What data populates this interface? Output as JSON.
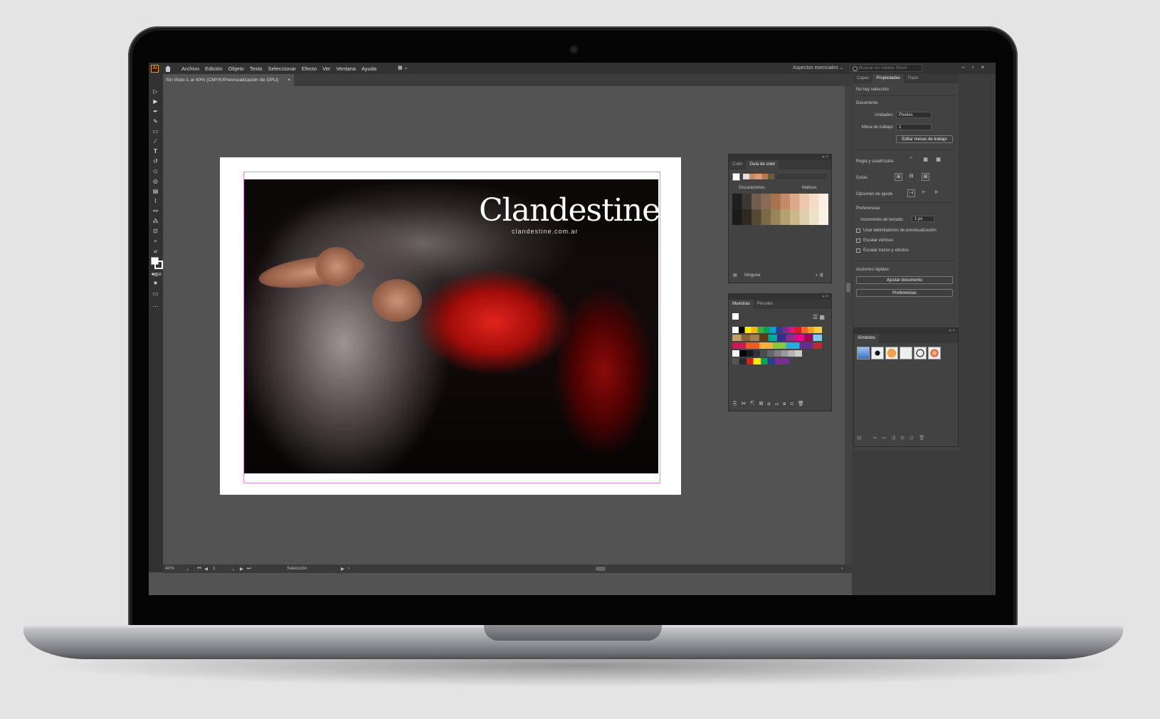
{
  "app": {
    "logo": "Ai",
    "menu": [
      "Archivo",
      "Edición",
      "Objeto",
      "Texto",
      "Seleccionar",
      "Efecto",
      "Ver",
      "Ventana",
      "Ayuda"
    ],
    "workspace": "Aspectos esenciales",
    "search_placeholder": "Buscar en Adobe Stock",
    "window_buttons": "–▫×"
  },
  "document": {
    "tab_title": "Sin título-1 al 40% (CMYK/Previsualización de GPU)",
    "close": "×"
  },
  "artwork": {
    "logo_text": "Clandestine",
    "logo_url": "clandestine.com.ar"
  },
  "status": {
    "zoom": "40%",
    "artboard_num": "1",
    "tool": "Selección"
  },
  "color_guide_panel": {
    "tabs": [
      "Color",
      "Guía de color"
    ],
    "col_left": "Oscuraciones",
    "col_right": "Matices",
    "footer": "Ninguna"
  },
  "swatches_panel": {
    "tabs": [
      "Muestras",
      "Pinceles"
    ]
  },
  "properties_panel": {
    "tabs": [
      "Capas",
      "Propiedades",
      "Trazo"
    ],
    "no_selection": "No hay selección",
    "document_heading": "Documento",
    "units_label": "Unidades:",
    "units_value": "Píxeles",
    "artboard_label": "Mesa de trabajo:",
    "artboard_value": "1",
    "edit_artboards": "Editar mesas de trabajo",
    "rulers_grids": "Regla y cuadrículas",
    "guides": "Guías",
    "snap_options": "Opciones de ajuste",
    "preferences_heading": "Preferencias",
    "keyboard_increment_label": "Incremento de teclado:",
    "keyboard_increment_value": "1 px",
    "check_preview_bounds": "Usar delimitadores de previsualización",
    "check_scale_corners": "Escalar vértices",
    "check_scale_strokes": "Escalar trazos y efectos",
    "quick_actions": "Acciones rápidas",
    "fit_document": "Ajustar documento",
    "preferences_button": "Preferencias"
  },
  "symbols_panel": {
    "title": "Símbolos"
  },
  "colors": {
    "app_bg": "#535353",
    "chrome": "#323232",
    "panel": "#424242",
    "accent_red": "#d81e16",
    "bleed_guide": "#e48be0"
  }
}
